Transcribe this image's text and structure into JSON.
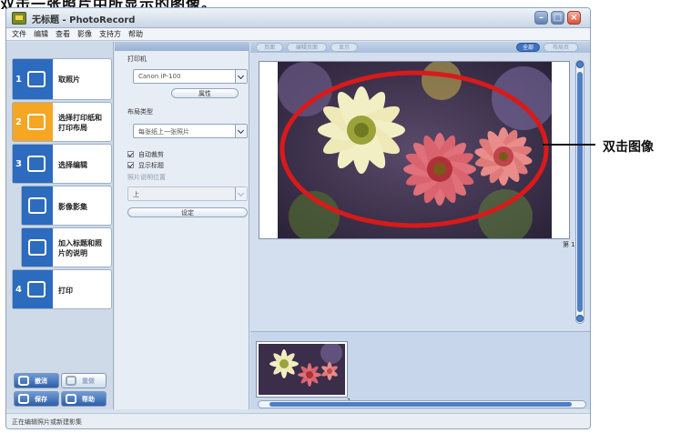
{
  "header_caption": "双击一张照片中所显示的图像。",
  "window": {
    "title": "无标题 - PhotoRecord",
    "menu": [
      "文件",
      "编辑",
      "查看",
      "影像",
      "支持方",
      "帮助"
    ]
  },
  "sidebar": {
    "steps": [
      {
        "number": "1",
        "label": "取照片",
        "icon": "import-photo-icon",
        "active": false
      },
      {
        "number": "2",
        "label": "选择打印纸和\n打印布局",
        "icon": "layout-icon",
        "active": true
      },
      {
        "number": "3",
        "label": "选择编辑",
        "icon": "edit-icon",
        "active": false
      },
      {
        "number": "",
        "label": "影像影集",
        "icon": "album-icon",
        "active": false
      },
      {
        "number": "",
        "label": "加入标题和照\n片的说明",
        "icon": "caption-icon",
        "active": false
      },
      {
        "number": "4",
        "label": "打印",
        "icon": "print-icon",
        "active": false
      }
    ],
    "bottom_buttons": [
      {
        "label": "撤消",
        "icon": "undo-icon",
        "enabled": true
      },
      {
        "label": "重做",
        "icon": "redo-icon",
        "enabled": false
      },
      {
        "label": "保存",
        "icon": "save-icon",
        "enabled": true
      },
      {
        "label": "帮助",
        "icon": "help-icon",
        "enabled": true
      }
    ]
  },
  "status_bar": "正在编辑照片或新建影集",
  "options": {
    "printer_label": "打印机",
    "printer_value": "Canon iP-100",
    "printer_settings_button": "属性",
    "layout_label": "布局类型",
    "layout_value": "每张纸上一张照片",
    "checkboxes": [
      {
        "label": "自动裁剪",
        "checked": true
      },
      {
        "label": "显示标题",
        "checked": true
      }
    ],
    "caption_label": "照片说明位置",
    "caption_value": "上",
    "apply_button": "设定"
  },
  "preview": {
    "tabs": [
      {
        "label": "页面",
        "selected": false
      },
      {
        "label": "编辑页面",
        "selected": false
      },
      {
        "label": "显示",
        "selected": false
      },
      {
        "label": "全部",
        "selected": true
      },
      {
        "label": "布局页",
        "selected": false
      }
    ],
    "page_number": "第 1",
    "thumb_page": "1"
  },
  "annotation": {
    "text": "双击图像",
    "color": "#d81a1a"
  },
  "colors": {
    "accent_blue": "#2d6bbf",
    "active_step": "#f5a623",
    "ellipse_red": "#d81a1a"
  }
}
